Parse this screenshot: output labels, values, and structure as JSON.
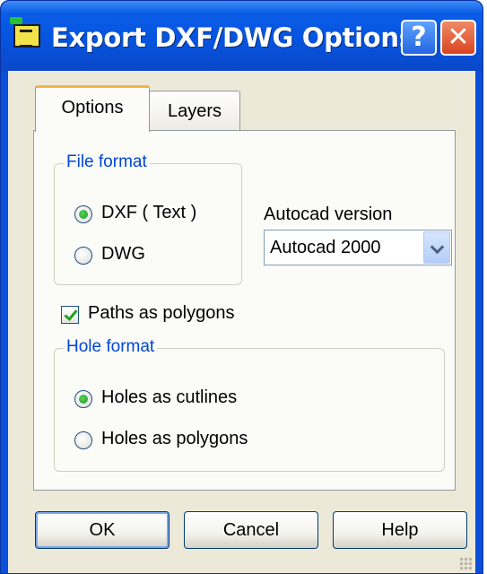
{
  "window": {
    "title": "Export DXF/DWG Options",
    "help_glyph": "?",
    "close_glyph": "✕"
  },
  "tabs": [
    {
      "label": "Options",
      "selected": true
    },
    {
      "label": "Layers",
      "selected": false
    }
  ],
  "file_format": {
    "legend": "File format",
    "options": [
      {
        "label": "DXF ( Text )",
        "checked": true
      },
      {
        "label": "DWG",
        "checked": false
      }
    ]
  },
  "autocad": {
    "label": "Autocad version",
    "selected": "Autocad 2000"
  },
  "paths_as_polygons": {
    "label": "Paths as polygons",
    "checked": true
  },
  "hole_format": {
    "legend": "Hole format",
    "options": [
      {
        "label": "Holes as cutlines",
        "checked": true
      },
      {
        "label": "Holes as polygons",
        "checked": false
      }
    ]
  },
  "buttons": {
    "ok": "OK",
    "cancel": "Cancel",
    "help": "Help"
  },
  "colors": {
    "titlebar": "#0654df",
    "dialog_bg": "#ece9d8",
    "legend_text": "#0046d5",
    "tab_highlight": "#f7b33b"
  }
}
